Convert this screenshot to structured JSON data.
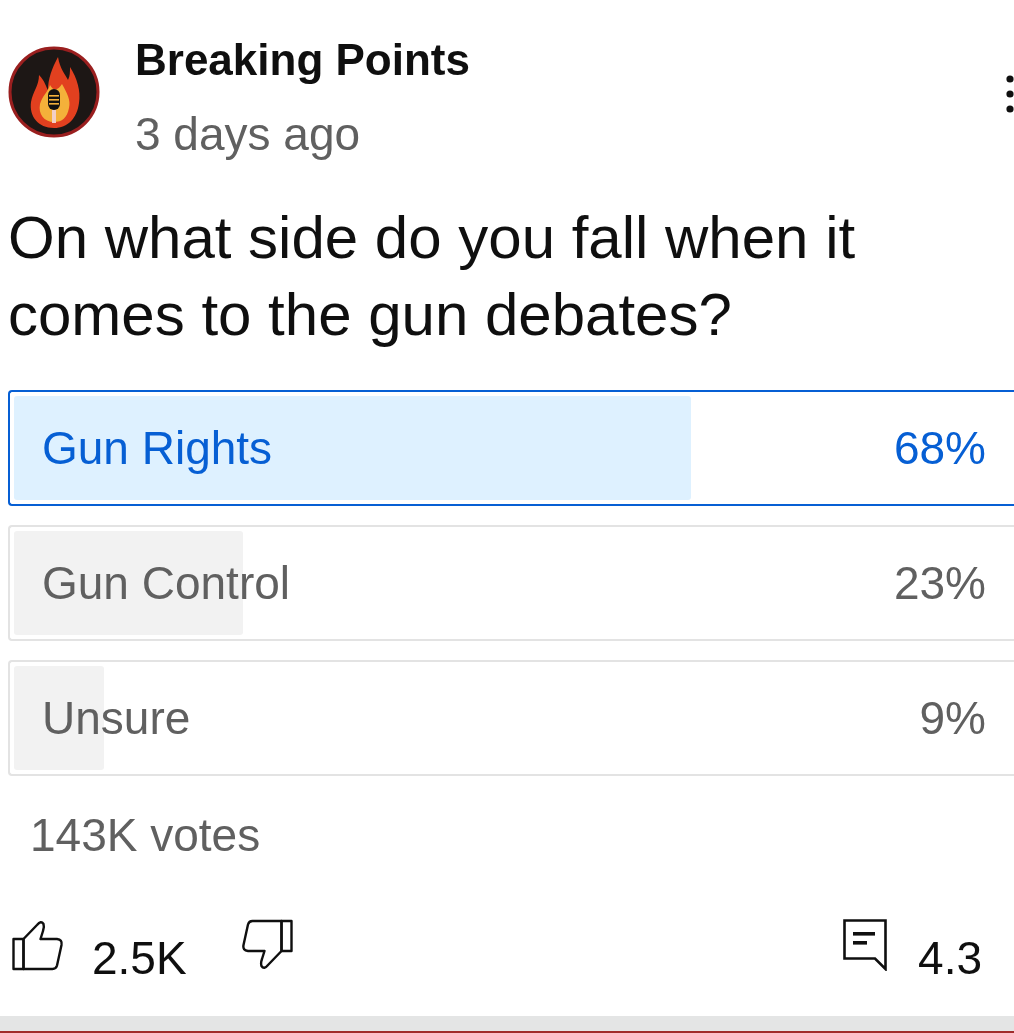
{
  "post": {
    "channel": "Breaking Points",
    "time": "3 days ago",
    "question": "On what side do you fall when it comes to the gun debates?",
    "poll": {
      "options": [
        {
          "label": "Gun Rights",
          "percent": "68%",
          "level": 0.68,
          "selected": true
        },
        {
          "label": "Gun Control",
          "percent": "23%",
          "level": 0.23,
          "selected": false
        },
        {
          "label": "Unsure",
          "percent": "9%",
          "level": 0.09,
          "selected": false
        }
      ],
      "votes": "143K votes"
    },
    "likes": "2.5K",
    "comments": "4.3"
  }
}
